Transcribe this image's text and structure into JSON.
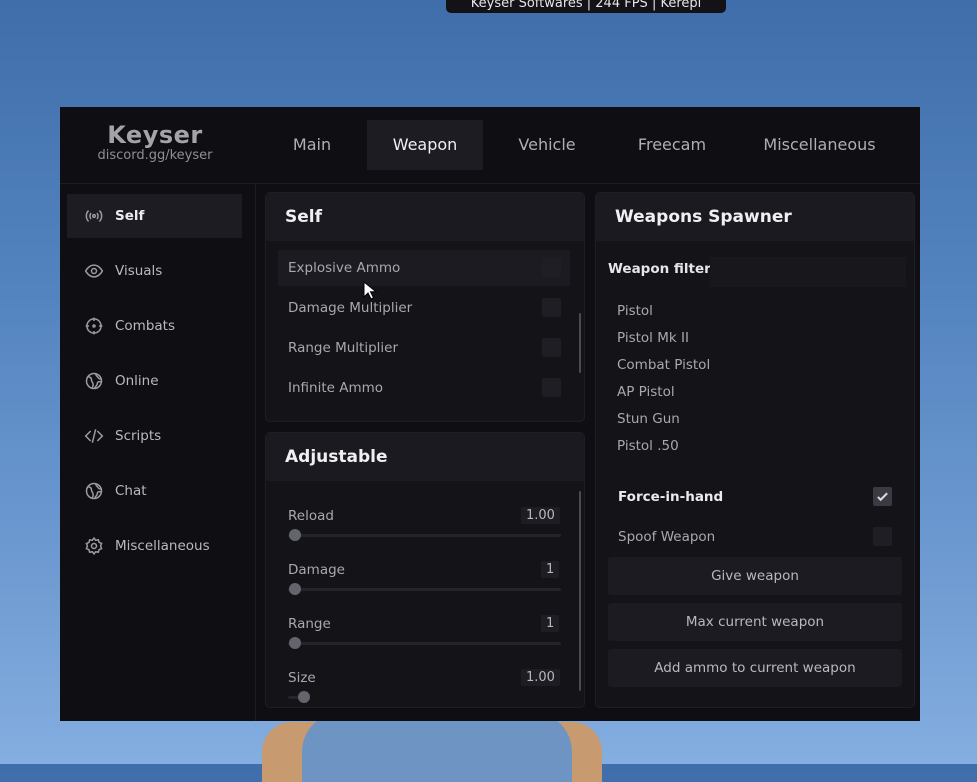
{
  "overlay": {
    "title": "Keyser Softwares | 244 FPS | Kerepi"
  },
  "brand": {
    "name": "Keyser",
    "sub": "discord.gg/keyser"
  },
  "tabs": [
    {
      "label": "Main"
    },
    {
      "label": "Weapon"
    },
    {
      "label": "Vehicle"
    },
    {
      "label": "Freecam"
    },
    {
      "label": "Miscellaneous"
    }
  ],
  "active_tab": "Weapon",
  "sidebar": {
    "items": [
      {
        "label": "Self",
        "icon": "broadcast-icon"
      },
      {
        "label": "Visuals",
        "icon": "eye-icon"
      },
      {
        "label": "Combats",
        "icon": "crosshair-icon"
      },
      {
        "label": "Online",
        "icon": "globe-icon"
      },
      {
        "label": "Scripts",
        "icon": "code-icon"
      },
      {
        "label": "Chat",
        "icon": "globe-icon"
      },
      {
        "label": "Miscellaneous",
        "icon": "gear-icon"
      }
    ],
    "active": "Self"
  },
  "self_panel": {
    "title": "Self",
    "options": [
      {
        "label": "Explosive Ammo",
        "checked": false
      },
      {
        "label": "Damage Multiplier",
        "checked": false
      },
      {
        "label": "Range Multiplier",
        "checked": false
      },
      {
        "label": "Infinite Ammo",
        "checked": false
      }
    ]
  },
  "adjustable_panel": {
    "title": "Adjustable",
    "sliders": [
      {
        "label": "Reload",
        "value": "1.00"
      },
      {
        "label": "Damage",
        "value": "1"
      },
      {
        "label": "Range",
        "value": "1"
      },
      {
        "label": "Size",
        "value": "1.00"
      }
    ]
  },
  "spawner_panel": {
    "title": "Weapons Spawner",
    "filter_label": "Weapon filter",
    "filter_value": "",
    "weapons": [
      "Pistol",
      "Pistol Mk II",
      "Combat Pistol",
      "AP Pistol",
      "Stun Gun",
      "Pistol .50"
    ],
    "force_in_hand": {
      "label": "Force-in-hand",
      "checked": true
    },
    "spoof_weapon": {
      "label": "Spoof Weapon",
      "checked": false
    },
    "buttons": {
      "give": "Give weapon",
      "max": "Max current weapon",
      "add_ammo": "Add ammo to current weapon"
    }
  }
}
